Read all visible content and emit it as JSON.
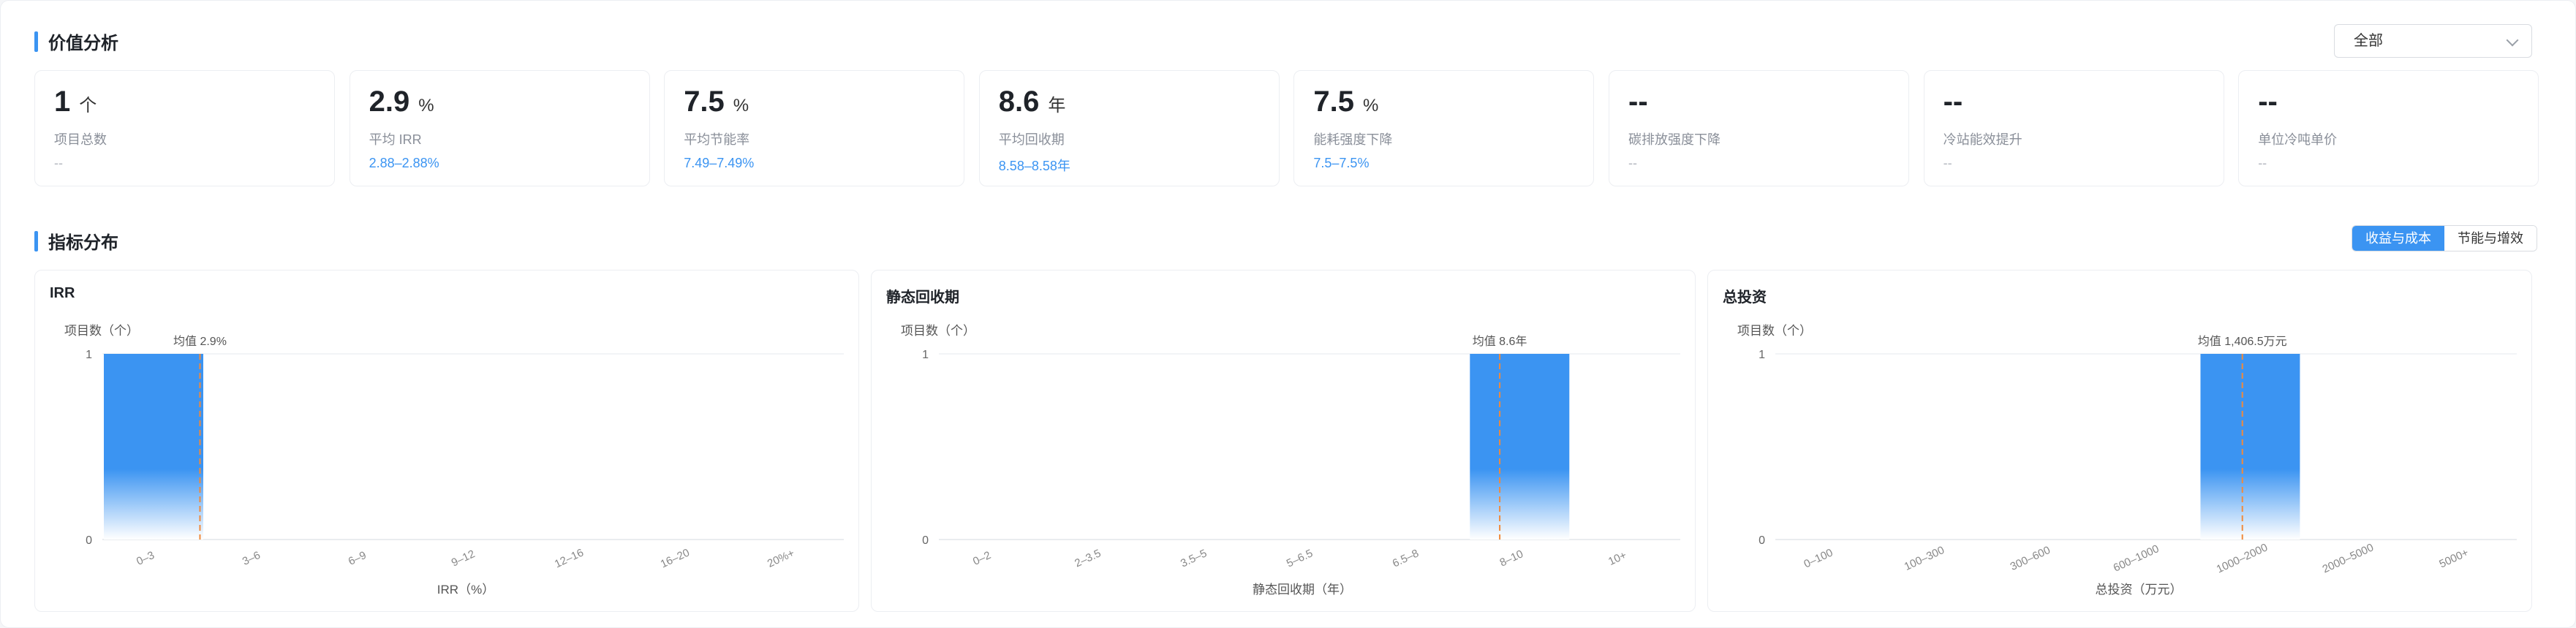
{
  "sections": {
    "value_analysis": "价值分析",
    "distribution": "指标分布"
  },
  "filter": {
    "selected": "全部"
  },
  "kpis": [
    {
      "value": "1",
      "unit": "个",
      "label": "项目总数",
      "range": "--"
    },
    {
      "value": "2.9",
      "unit": "%",
      "label": "平均 IRR",
      "range": "2.88–2.88%"
    },
    {
      "value": "7.5",
      "unit": "%",
      "label": "平均节能率",
      "range": "7.49–7.49%"
    },
    {
      "value": "8.6",
      "unit": "年",
      "label": "平均回收期",
      "range": "8.58–8.58年"
    },
    {
      "value": "7.5",
      "unit": "%",
      "label": "能耗强度下降",
      "range": "7.5–7.5%"
    },
    {
      "value": "--",
      "unit": "",
      "label": "碳排放强度下降",
      "range": "--"
    },
    {
      "value": "--",
      "unit": "",
      "label": "冷站能效提升",
      "range": "--"
    },
    {
      "value": "--",
      "unit": "",
      "label": "单位冷吨单价",
      "range": "--"
    }
  ],
  "toggle": [
    {
      "label": "收益与成本",
      "active": true
    },
    {
      "label": "节能与增效",
      "active": false
    }
  ],
  "colors": {
    "accent": "#3b94f2",
    "mean_line": "#f08a3c"
  },
  "chart_data": [
    {
      "type": "bar",
      "title": "IRR",
      "ylabel": "项目数（个）",
      "xlabel": "IRR（%）",
      "categories": [
        "0–3",
        "3–6",
        "6–9",
        "9–12",
        "12–16",
        "16–20",
        "20%+"
      ],
      "values": [
        1,
        0,
        0,
        0,
        0,
        0,
        0
      ],
      "ylim": [
        0,
        1
      ],
      "yticks": [
        "0",
        "1"
      ],
      "mean": 2.9,
      "mean_label": "均值 2.9%",
      "bin_edges": [
        0,
        3,
        6,
        9,
        12,
        16,
        20,
        24
      ],
      "grid": true
    },
    {
      "type": "bar",
      "title": "静态回收期",
      "ylabel": "项目数（个）",
      "xlabel": "静态回收期（年）",
      "categories": [
        "0–2",
        "2–3.5",
        "3.5–5",
        "5–6.5",
        "6.5–8",
        "8–10",
        "10+"
      ],
      "values": [
        0,
        0,
        0,
        0,
        0,
        1,
        0
      ],
      "ylim": [
        0,
        1
      ],
      "yticks": [
        "0",
        "1"
      ],
      "mean": 8.6,
      "mean_label": "均值 8.6年",
      "bin_edges": [
        0,
        2,
        3.5,
        5,
        6.5,
        8,
        10,
        12
      ],
      "grid": true
    },
    {
      "type": "bar",
      "title": "总投资",
      "ylabel": "项目数（个）",
      "xlabel": "总投资（万元）",
      "categories": [
        "0–100",
        "100–300",
        "300–600",
        "600–1000",
        "1000–2000",
        "2000–5000",
        "5000+"
      ],
      "values": [
        0,
        0,
        0,
        0,
        1,
        0,
        0
      ],
      "ylim": [
        0,
        1
      ],
      "yticks": [
        "0",
        "1"
      ],
      "mean": 1406.5,
      "mean_label": "均值 1,406.5万元",
      "bin_edges": [
        0,
        100,
        300,
        600,
        1000,
        2000,
        5000,
        8000
      ],
      "grid": true
    }
  ]
}
